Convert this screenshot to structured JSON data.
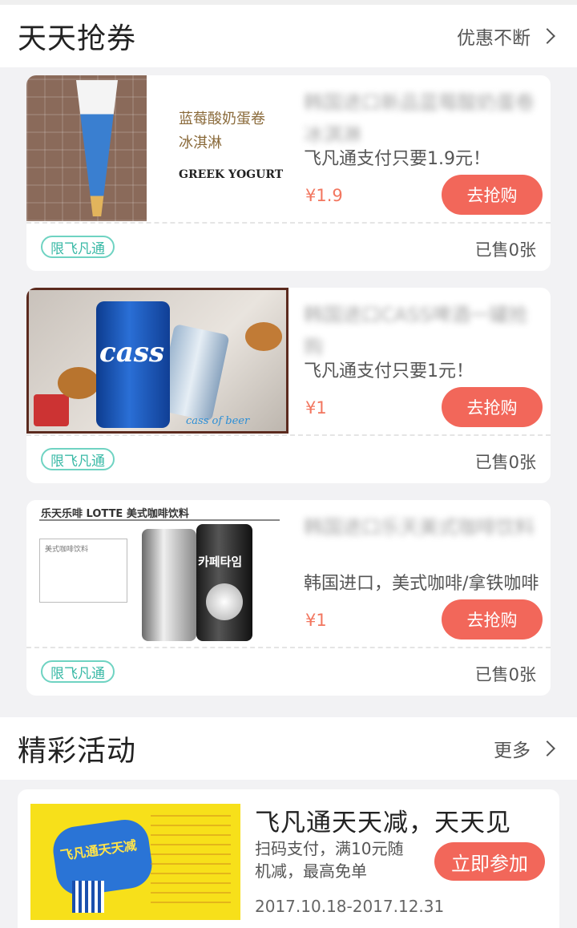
{
  "coupon_section": {
    "title": "天天抢券",
    "more_label": "优惠不断"
  },
  "coupons": [
    {
      "title": "韩国进口新品蓝莓酸奶蛋卷冰淇淋",
      "image_text": [
        "蓝莓酸奶蛋卷",
        "冰淇淋",
        "GREEK YOGURT"
      ],
      "desc": "飞凡通支付只要1.9元！",
      "price": "¥1.9",
      "buy_label": "去抢购",
      "badge": "限飞凡通",
      "sold": "已售0张"
    },
    {
      "title": "韩国进口CASS啤酒一罐抢购",
      "image_text": [
        "cass of beer"
      ],
      "desc": "飞凡通支付只要1元！",
      "price": "¥1",
      "buy_label": "去抢购",
      "badge": "限飞凡通",
      "sold": "已售0张"
    },
    {
      "title": "韩国进口乐天美式咖啡饮料",
      "image_text": [
        "乐天乐啡 LOTTE 美式咖啡饮料",
        "美式咖啡饮料",
        "카페타임"
      ],
      "desc": "韩国进口，美式咖啡/拿铁咖啡",
      "price": "¥1",
      "buy_label": "去抢购",
      "badge": "限飞凡通",
      "sold": "已售0张"
    }
  ],
  "activity_section": {
    "title": "精彩活动",
    "more_label": "更多"
  },
  "activity": {
    "title": "飞凡通天天减，天天见",
    "desc": "扫码支付，满10元随机减，最高免单",
    "join_label": "立即参加",
    "date_range": "2017.10.18-2017.12.31",
    "image_text": "飞凡通天天减"
  },
  "colors": {
    "accent": "#f2675a",
    "badge_border": "#6fd3c2",
    "price": "#f2765f"
  },
  "icons": [
    "chevron-right-icon"
  ]
}
